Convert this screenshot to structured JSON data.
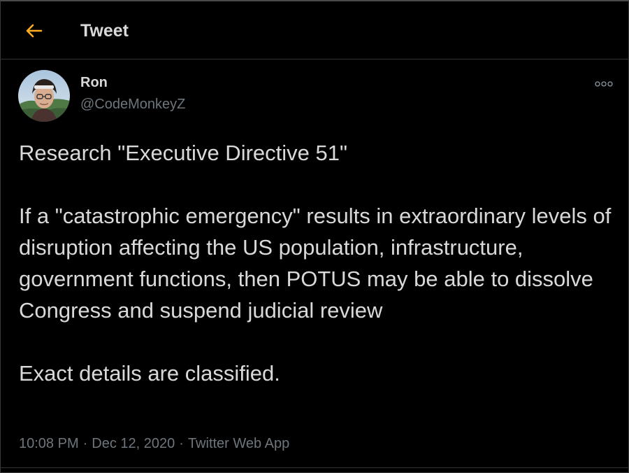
{
  "colors": {
    "accent": "#ffad1f",
    "background": "#000000",
    "text": "#d9d9d9",
    "muted": "#6e767d"
  },
  "header": {
    "back_icon": "arrow-left-icon",
    "title": "Tweet"
  },
  "author": {
    "avatar_icon": "profile-photo",
    "name": "Ron",
    "handle": "@CodeMonkeyZ",
    "more_icon": "more-options-icon"
  },
  "tweet": {
    "paragraphs": [
      "Research \"Executive Directive 51\"",
      "If a \"catastrophic emergency\" results in extraordinary levels of disruption affecting the US population, infrastructure, government functions, then POTUS may be able to dissolve Congress and suspend judicial review",
      "Exact details are classified."
    ],
    "time": "10:08 PM",
    "date": "Dec 12, 2020",
    "source": "Twitter Web App",
    "separator": "·"
  }
}
